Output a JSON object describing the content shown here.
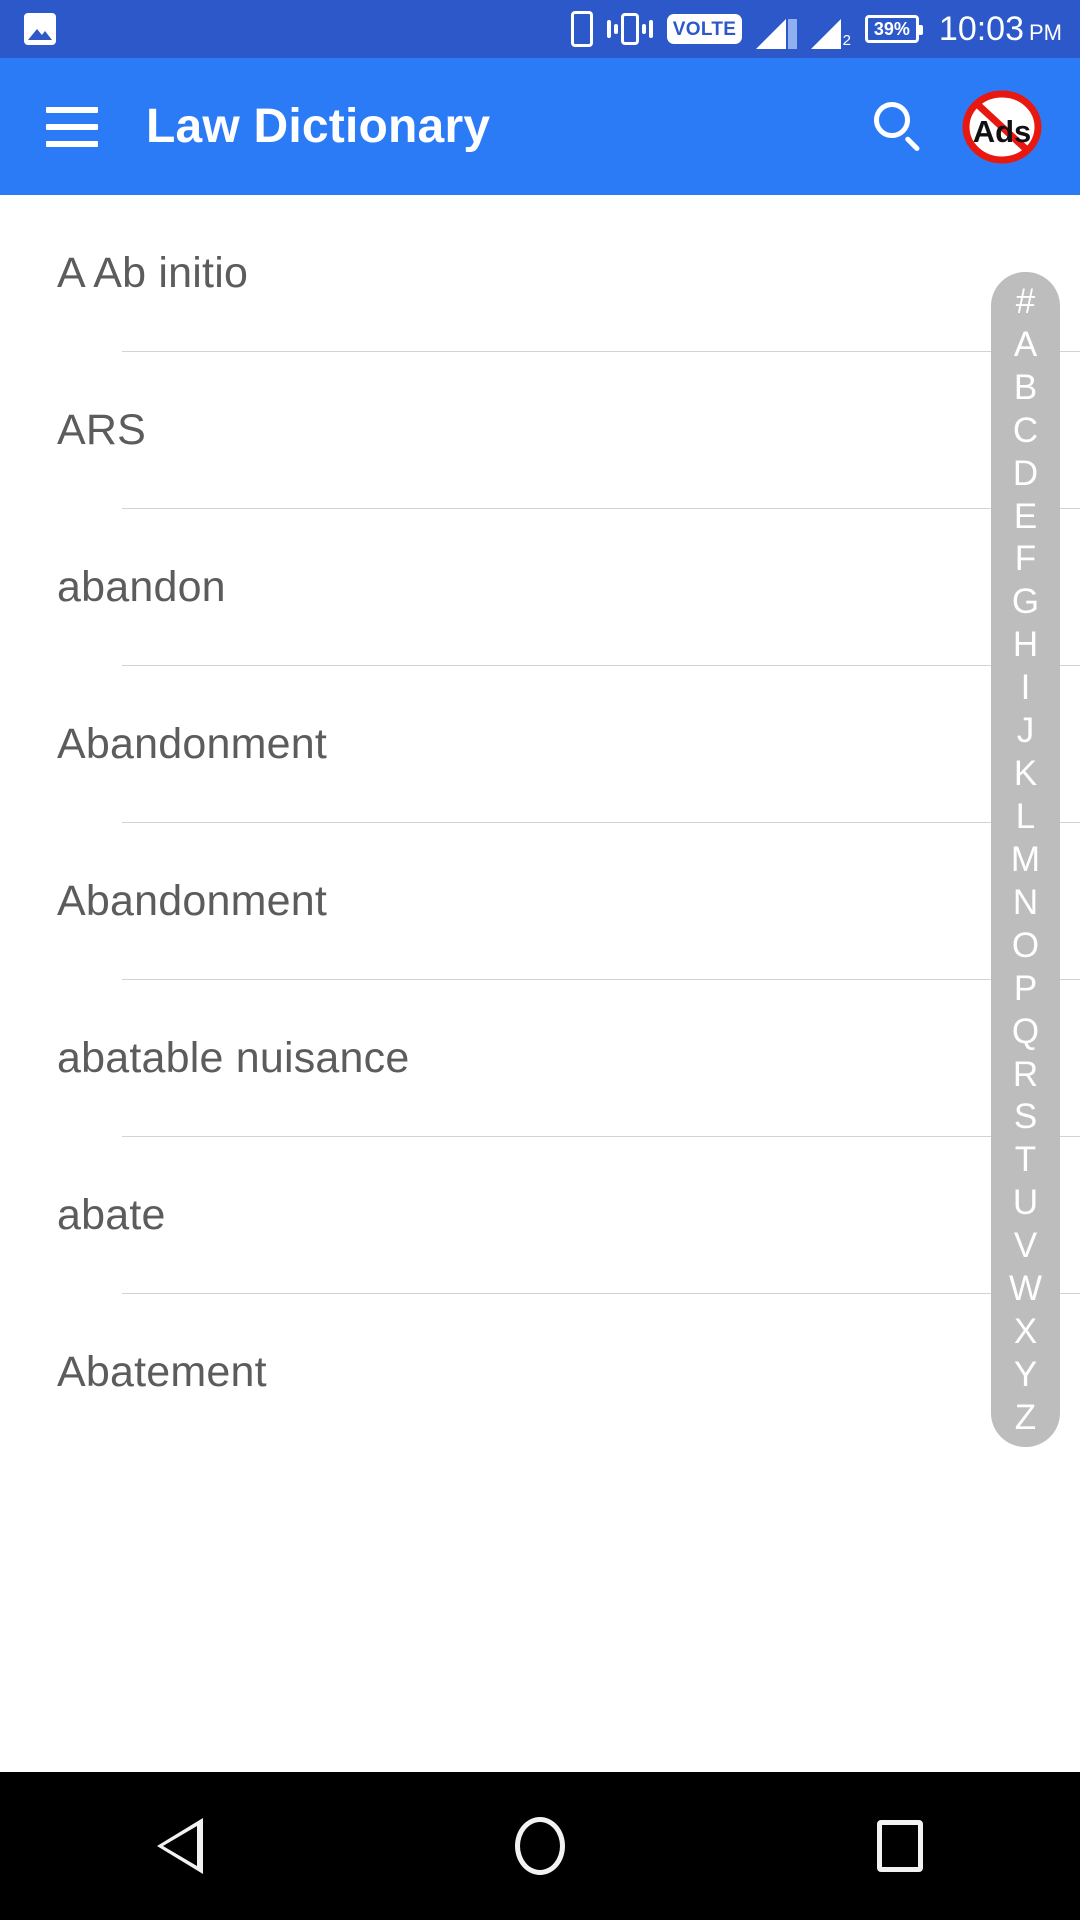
{
  "status_bar": {
    "background_color": "#2d58c9",
    "left_icons": [
      {
        "name": "gallery-icon",
        "label": "image"
      }
    ],
    "right_icons": [
      {
        "name": "phone-icon",
        "label": "phone"
      },
      {
        "name": "vibrate-icon",
        "label": "vibrate"
      },
      {
        "name": "volte-icon",
        "label": "VOLTE"
      },
      {
        "name": "signal-icon-sim1",
        "label": "1"
      },
      {
        "name": "signal-icon-sim2",
        "label": "2"
      }
    ],
    "battery": "39%",
    "time": "10:03",
    "am_pm": "PM"
  },
  "app_bar": {
    "background_color": "#2b7bf6",
    "title": "Law Dictionary",
    "menu_icon": "hamburger-menu-icon",
    "search_icon": "search-icon",
    "no_ads_icon": "no-ads-icon",
    "no_ads_label": "Ads"
  },
  "list": {
    "text_color": "#5c5c5c",
    "divider_color": "#d3d3d3",
    "items": [
      {
        "label": "A Ab initio"
      },
      {
        "label": "ARS"
      },
      {
        "label": "abandon"
      },
      {
        "label": "Abandonment"
      },
      {
        "label": "Abandonment"
      },
      {
        "label": "abatable nuisance"
      },
      {
        "label": "abate"
      },
      {
        "label": "Abatement"
      }
    ]
  },
  "alpha_index": {
    "background_color": "#bdbdbd",
    "text_color": "#ffffff",
    "letters": [
      "#",
      "A",
      "B",
      "C",
      "D",
      "E",
      "F",
      "G",
      "H",
      "I",
      "J",
      "K",
      "L",
      "M",
      "N",
      "O",
      "P",
      "Q",
      "R",
      "S",
      "T",
      "U",
      "V",
      "W",
      "X",
      "Y",
      "Z"
    ]
  },
  "nav_bar": {
    "background_color": "#000000",
    "buttons": [
      {
        "name": "back-button",
        "icon": "triangle-back-icon"
      },
      {
        "name": "home-button",
        "icon": "circle-home-icon"
      },
      {
        "name": "recents-button",
        "icon": "square-recents-icon"
      }
    ]
  }
}
